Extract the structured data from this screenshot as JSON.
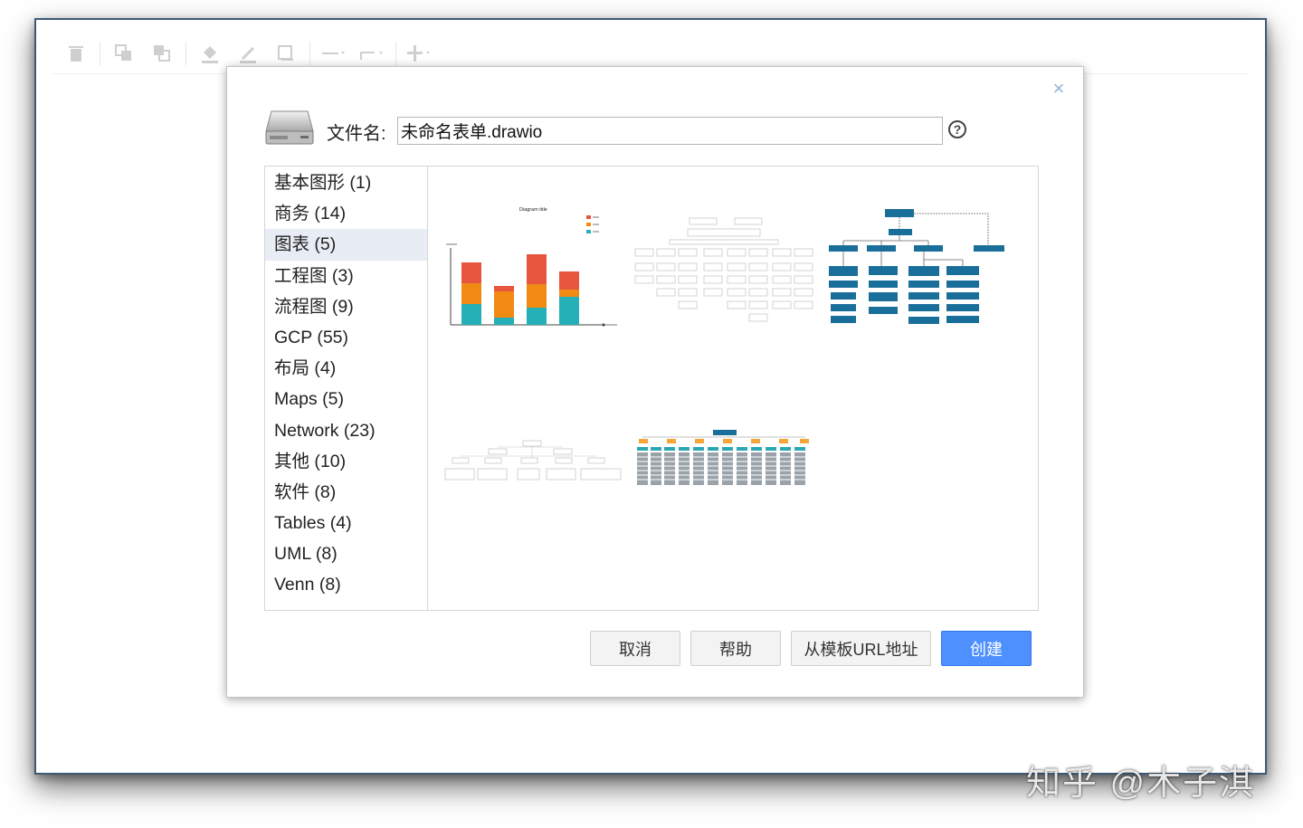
{
  "dialog": {
    "filename_label": "文件名:",
    "filename_value": "未命名表单.drawio",
    "help_glyph": "?",
    "close_glyph": "×"
  },
  "categories": [
    {
      "label": "基本图形 (1)"
    },
    {
      "label": "商务 (14)"
    },
    {
      "label": "图表 (5)",
      "selected": true
    },
    {
      "label": "工程图 (3)"
    },
    {
      "label": "流程图 (9)"
    },
    {
      "label": "GCP (55)"
    },
    {
      "label": "布局 (4)"
    },
    {
      "label": "Maps (5)"
    },
    {
      "label": "Network (23)"
    },
    {
      "label": "其他 (10)"
    },
    {
      "label": "软件 (8)"
    },
    {
      "label": "Tables (4)"
    },
    {
      "label": "UML (8)"
    },
    {
      "label": "Venn (8)"
    }
  ],
  "thumbnails": {
    "bar_chart_title": "Diagram title",
    "items": [
      "bar-chart",
      "org-chart-gray",
      "org-chart-blue",
      "tree-chart-gray",
      "org-chart-grid"
    ]
  },
  "buttons": {
    "cancel": "取消",
    "help": "帮助",
    "from_template_url": "从模板URL地址",
    "create": "创建"
  },
  "watermark": "知乎 @木子淇",
  "colors": {
    "primary_button": "#4d90fe",
    "selected_category": "#e8ecf4",
    "bar_red": "#e8553f",
    "bar_orange": "#f18a12",
    "bar_teal": "#25b0b7",
    "org_blue": "#1a6f9a"
  },
  "icons": {
    "toolbar": [
      "delete-icon",
      "to-front-icon",
      "to-back-icon",
      "fill-color-icon",
      "line-color-icon",
      "shadow-icon",
      "connection-icon",
      "waypoints-icon",
      "insert-icon"
    ],
    "drive": "hard-drive-icon"
  }
}
